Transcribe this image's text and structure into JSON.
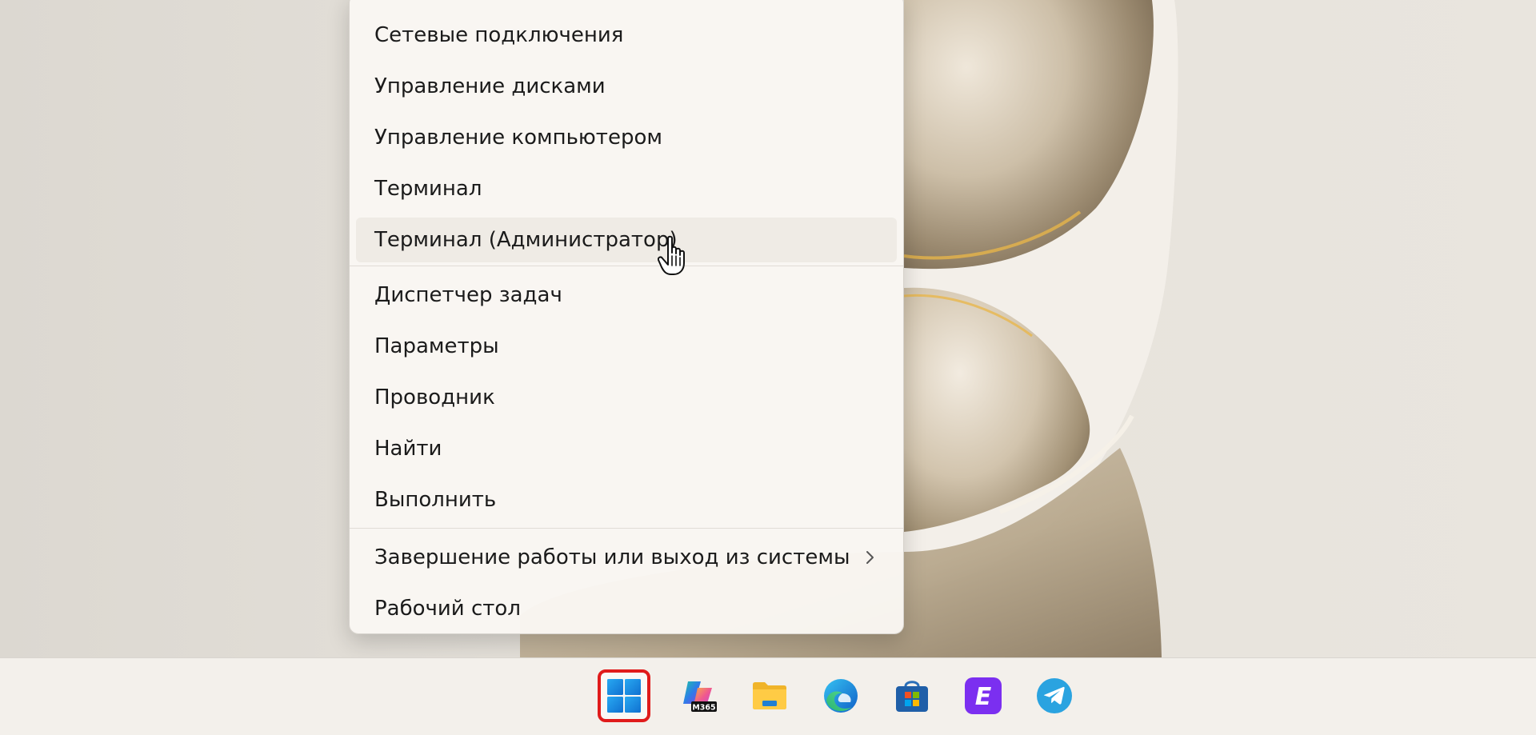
{
  "menu": {
    "items": [
      {
        "label": "Сетевые подключения"
      },
      {
        "label": "Управление дисками"
      },
      {
        "label": "Управление компьютером"
      },
      {
        "label": "Терминал"
      },
      {
        "label": "Терминал (Администратор)"
      },
      {
        "label": "Диспетчер задач"
      },
      {
        "label": "Параметры"
      },
      {
        "label": "Проводник"
      },
      {
        "label": "Найти"
      },
      {
        "label": "Выполнить"
      },
      {
        "label": "Завершение работы или выход из системы"
      },
      {
        "label": "Рабочий стол"
      }
    ],
    "hovered_index": 4
  },
  "taskbar": {
    "apps": [
      {
        "name": "start-icon"
      },
      {
        "name": "copilot-m365-icon",
        "badge": "M365"
      },
      {
        "name": "file-explorer-icon"
      },
      {
        "name": "edge-icon"
      },
      {
        "name": "microsoft-store-icon"
      },
      {
        "name": "e-app-icon",
        "letter": "E"
      },
      {
        "name": "telegram-icon"
      }
    ]
  },
  "colors": {
    "start_highlight": "#e01b1b",
    "windows_blue": "#1f8fe6",
    "e_app_purple": "#7b2ff0",
    "telegram_blue": "#2aa3e0"
  }
}
